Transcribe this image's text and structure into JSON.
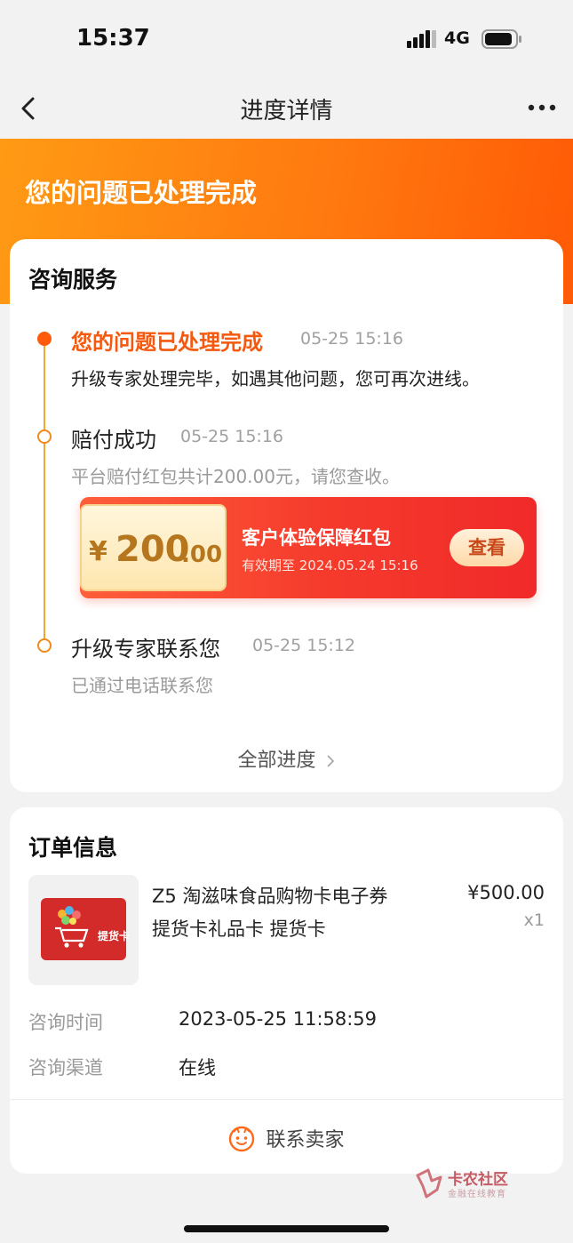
{
  "status_bar": {
    "time": "15:37",
    "network": "4G"
  },
  "nav": {
    "title": "进度详情"
  },
  "header": {
    "title": "您的问题已处理完成"
  },
  "consult": {
    "heading": "咨询服务",
    "steps": [
      {
        "title": "您的问题已处理完成",
        "time": "05-25 15:16",
        "desc": "升级专家处理完毕，如遇其他问题，您可再次进线。"
      },
      {
        "title": "赔付成功",
        "time": "05-25 15:16",
        "desc": "平台赔付红包共计200.00元，请您查收。"
      },
      {
        "title": "升级专家联系您",
        "time": "05-25 15:12",
        "desc": "已通过电话联系您"
      }
    ],
    "coupon": {
      "currency": "¥",
      "amount_int": "200",
      "amount_dec": ".00",
      "name": "客户体验保障红包",
      "validity": "有效期至 2024.05.24 15:16",
      "view_label": "查看"
    },
    "all_progress_label": "全部进度"
  },
  "order": {
    "heading": "订单信息",
    "product": {
      "name_line1": "Z5 淘滋味食品购物卡电子券",
      "name_line2": "提货卡礼品卡 提货卡",
      "price": "¥500.00",
      "qty": "x1",
      "card_text": "提货卡"
    },
    "info": [
      {
        "label": "咨询时间",
        "value": "2023-05-25 11:58:59"
      },
      {
        "label": "咨询渠道",
        "value": "在线"
      }
    ],
    "contact_label": "联系卖家"
  },
  "watermark": {
    "title": "卡农社区",
    "subtitle": "金融在线教育"
  },
  "colors": {
    "accent": "#ff5b0a",
    "coupon_red": "#f53a2c",
    "timeline": "#f5a630"
  }
}
